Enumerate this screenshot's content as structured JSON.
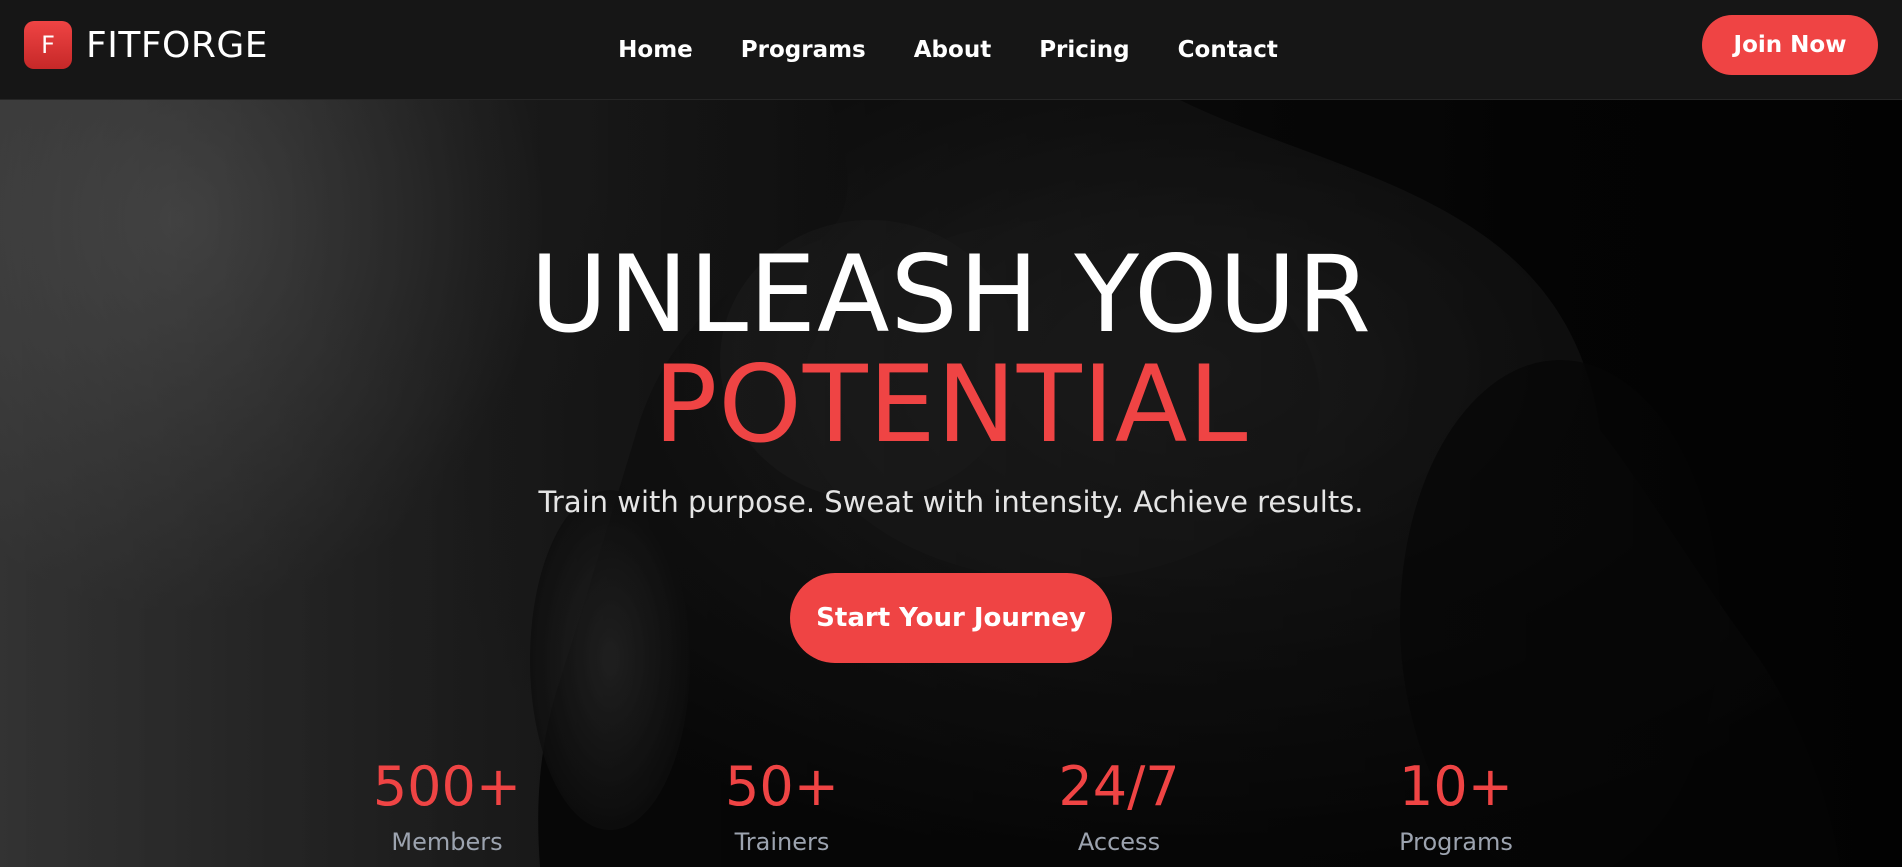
{
  "brand": {
    "logo_letter": "F",
    "name": "FITFORGE"
  },
  "nav": {
    "links": [
      "Home",
      "Programs",
      "About",
      "Pricing",
      "Contact"
    ],
    "cta_label": "Join Now"
  },
  "hero": {
    "headline_line1": "UNLEASH YOUR",
    "headline_line2": "POTENTIAL",
    "subtitle": "Train with purpose. Sweat with intensity. Achieve results.",
    "cta_label": "Start Your Journey",
    "stats": [
      {
        "value": "500+",
        "label": "Members"
      },
      {
        "value": "50+",
        "label": "Trainers"
      },
      {
        "value": "24/7",
        "label": "Access"
      },
      {
        "value": "10+",
        "label": "Programs"
      }
    ]
  },
  "colors": {
    "accent": "#ef4444",
    "navbar_bg": "#161616",
    "stat_label": "#9ca3af"
  }
}
